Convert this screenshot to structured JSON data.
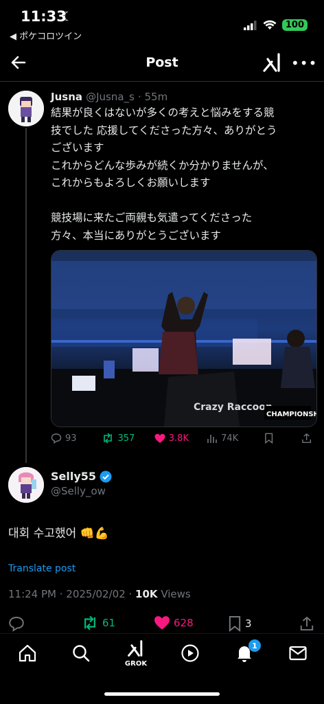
{
  "status_bar": {
    "time": "11:33",
    "back_app": "◀ ポケコロツイン",
    "battery": "100"
  },
  "header": {
    "title": "Post"
  },
  "parent_tweet": {
    "name": "Jusna",
    "handle": "@Jusna_s",
    "time": "· 55m",
    "text": "結果が良くはないが多くの考えと悩みをする競\n技でした 応援してくださった方々、ありがとう\nございます\nこれからどんな歩みが続くか分かりませんが、\nこれからもよろしくお願いします\n\n競技場に来たご両親も気遣ってくださった\n方々、本当にありがとうございます",
    "media_overlay": {
      "brand": "Crazy Raccoon",
      "banner": "CHAMPIONSHIP"
    },
    "actions": {
      "replies": "93",
      "reposts": "357",
      "likes": "3.8K",
      "views": "74K"
    }
  },
  "main_tweet": {
    "name": "Selly55",
    "handle": "@Selly_ow",
    "text": "대회 수고했어 ",
    "emoji": "👊💪",
    "translate": "Translate post",
    "meta_time": "11:24 PM · 2025/02/02 · ",
    "meta_views_count": "10K",
    "meta_views_label": " Views",
    "actions": {
      "reposts": "61",
      "likes": "628",
      "bookmarks": "3"
    }
  },
  "tabbar": {
    "grok_label": "GROK",
    "notifications_badge": "1"
  },
  "colors": {
    "accent": "#1d9bf0",
    "like": "#f91880",
    "repost": "#00ba7c"
  },
  "icons": [
    "back-arrow-icon",
    "grok-icon",
    "more-icon",
    "reply-icon",
    "repost-icon",
    "like-icon",
    "views-icon",
    "bookmark-icon",
    "share-icon",
    "home-icon",
    "search-icon",
    "play-icon",
    "bell-icon",
    "mail-icon",
    "verified-badge-icon"
  ]
}
